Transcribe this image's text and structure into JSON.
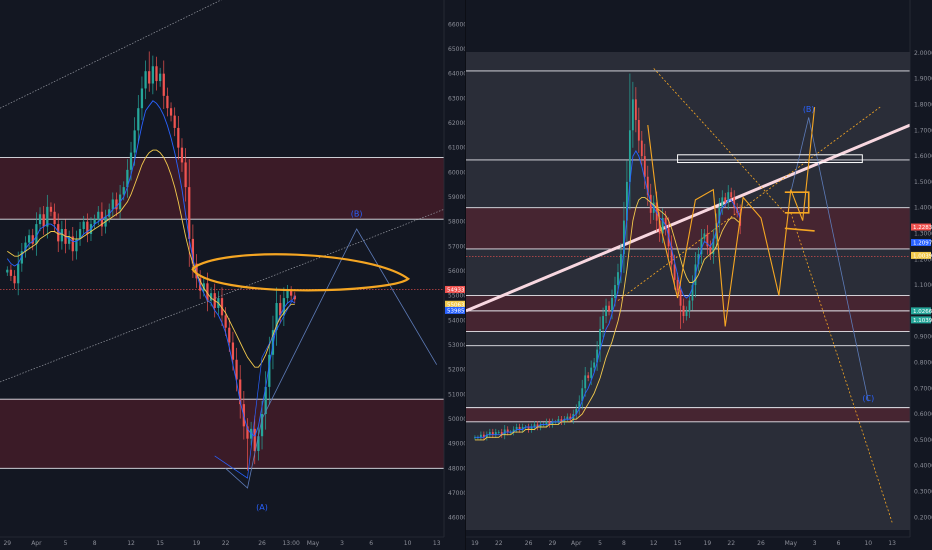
{
  "colors": {
    "background": "#131722",
    "candle_up": "#26a69a",
    "candle_down": "#ef5350",
    "ma_fast": "#2962ff",
    "ma_slow": "#f2c94c",
    "zone_fill": "#5c1f2b",
    "drawing_orange": "#f5a623",
    "trendline_pink": "#f8d7e0",
    "projection": "#9598a1"
  },
  "chart_data": [
    {
      "type": "candlestick",
      "panel": "left",
      "y_axis_labels": [
        "66000.00",
        "65000.00",
        "64000.00",
        "63000.00",
        "62000.00",
        "61000.00",
        "60000.00",
        "59000.00",
        "58000.00",
        "57000.00",
        "56000.00",
        "55000.00",
        "54000.00",
        "53000.00",
        "52000.00",
        "51000.00",
        "50000.00",
        "49000.00",
        "48000.00",
        "47000.00",
        "46000.00"
      ],
      "ylim": [
        45700,
        66500
      ],
      "x_tick_labels": [
        "29",
        "Apr",
        "5",
        "8",
        "12",
        "15",
        "19",
        "22",
        "26",
        "13:00",
        "May",
        "3",
        "6",
        "10",
        "13"
      ],
      "x_tick_index": [
        0,
        8,
        16,
        24,
        34,
        42,
        52,
        60,
        70,
        78,
        84,
        92,
        100,
        110,
        118
      ],
      "x_range": [
        -2,
        120
      ],
      "horizontal_levels": [
        60600,
        58100,
        50800,
        48000
      ],
      "zones": [
        [
          58100,
          60600
        ],
        [
          48000,
          50800
        ]
      ],
      "dotted_levels": [
        55250
      ],
      "price_tags": [
        {
          "text": "54933.13",
          "value": 55250,
          "color": "#ef5350"
        },
        {
          "text": "55063.81",
          "value": 54650,
          "color": "#f2c94c"
        },
        {
          "text": "53985.97",
          "value": 54400,
          "color": "#2962ff"
        }
      ],
      "wave_labels": [
        {
          "text": "(B)",
          "index": 96,
          "value": 58200
        },
        {
          "text": "(A)",
          "index": 70,
          "value": 46300
        }
      ],
      "closes": [
        56050,
        55800,
        55500,
        56300,
        56800,
        57150,
        57450,
        57100,
        57900,
        58300,
        57800,
        58600,
        58400,
        57900,
        57200,
        57700,
        57100,
        57400,
        56800,
        57300,
        57700,
        58000,
        57500,
        57900,
        58100,
        58400,
        57800,
        58200,
        58500,
        58900,
        58500,
        59100,
        59400,
        60100,
        60800,
        61700,
        62600,
        63400,
        64100,
        63600,
        64300,
        63700,
        64000,
        63100,
        62600,
        62300,
        61800,
        61000,
        60400,
        59400,
        57300,
        56300,
        55700,
        55200,
        55500,
        54800,
        55100,
        54500,
        54900,
        54200,
        53700,
        53100,
        52400,
        51600,
        50600,
        49700,
        49200,
        49600,
        48700,
        49300,
        50200,
        51300,
        52600,
        53600,
        54700,
        54200,
        54900,
        55200,
        55000,
        54850
      ],
      "highs": [
        null,
        null,
        null,
        null,
        null,
        null,
        null,
        null,
        null,
        null,
        null,
        null,
        null,
        null,
        null,
        null,
        null,
        null,
        null,
        null,
        null,
        null,
        null,
        null,
        null,
        null,
        null,
        null,
        null,
        null,
        null,
        null,
        null,
        null,
        null,
        null,
        null,
        null,
        null,
        64900,
        null,
        null,
        null,
        null,
        null,
        null,
        null,
        null,
        null,
        null,
        null,
        null,
        null,
        null,
        null,
        null,
        null,
        null,
        null,
        null,
        null,
        null,
        null,
        null,
        null,
        null,
        null,
        null,
        null,
        null,
        null,
        null,
        null,
        null,
        null,
        null,
        null,
        null,
        null,
        null
      ],
      "lows": [
        null,
        null,
        null,
        null,
        null,
        null,
        null,
        null,
        null,
        null,
        null,
        null,
        null,
        null,
        null,
        null,
        null,
        null,
        null,
        null,
        null,
        null,
        null,
        null,
        null,
        null,
        null,
        null,
        null,
        null,
        null,
        null,
        null,
        null,
        null,
        null,
        null,
        null,
        null,
        null,
        null,
        null,
        null,
        null,
        null,
        null,
        null,
        null,
        null,
        null,
        null,
        null,
        null,
        null,
        null,
        null,
        null,
        null,
        null,
        null,
        null,
        null,
        null,
        null,
        null,
        null,
        47900,
        null,
        null,
        null,
        null,
        null,
        null,
        null,
        null,
        null,
        null,
        null,
        null,
        null
      ],
      "ma_fast": [
        56500,
        56300,
        56200,
        56300,
        56600,
        56900,
        57100,
        57200,
        57400,
        57700,
        57800,
        57900,
        57900,
        57800,
        57600,
        57500,
        57400,
        57300,
        57200,
        57200,
        57300,
        57500,
        57600,
        57700,
        57900,
        58000,
        58100,
        58200,
        58300,
        58500,
        58600,
        58800,
        59000,
        59400,
        59900,
        60500,
        61200,
        61900,
        62500,
        62700,
        62900,
        62800,
        62600,
        62300,
        61900,
        61400,
        60800,
        60100,
        59300,
        58300,
        57300,
        56500,
        55900,
        55400,
        55100,
        54800,
        54700,
        54400,
        54200,
        53900,
        53500,
        52900,
        52200,
        51500,
        50700,
        50100,
        49600,
        49400,
        49300,
        49700,
        50500,
        51300,
        52200,
        53000,
        53800,
        54200,
        54500,
        54700,
        54800,
        54700
      ],
      "ma_slow": [
        56800,
        56700,
        56600,
        56600,
        56700,
        56800,
        56900,
        57000,
        57100,
        57300,
        57400,
        57500,
        57600,
        57600,
        57500,
        57500,
        57400,
        57400,
        57300,
        57300,
        57300,
        57400,
        57500,
        57600,
        57700,
        57800,
        57900,
        58000,
        58100,
        58200,
        58300,
        58400,
        58600,
        58800,
        59100,
        59500,
        59900,
        60300,
        60600,
        60800,
        60900,
        60900,
        60800,
        60600,
        60300,
        59900,
        59400,
        58800,
        58100,
        57400,
        56800,
        56300,
        55900,
        55600,
        55300,
        55100,
        54900,
        54800,
        54700,
        54500,
        54300,
        54000,
        53700,
        53400,
        53100,
        52800,
        52500,
        52300,
        52100,
        52100,
        52300,
        52600,
        53000,
        53400,
        53800,
        54100,
        54300,
        54500,
        54650,
        54650
      ],
      "projection_path": [
        [
          60,
          48000
        ],
        [
          66,
          47200
        ],
        [
          70,
          50000
        ],
        [
          96,
          57700
        ],
        [
          118,
          52200
        ]
      ],
      "projection_envelope": [
        [
          57,
          48500
        ],
        [
          66,
          47600
        ],
        [
          70,
          52500
        ],
        [
          79,
          55000
        ]
      ]
    },
    {
      "type": "candlestick",
      "panel": "right",
      "y_axis_labels": [
        "2.00000",
        "1.90000",
        "1.80000",
        "1.70000",
        "1.60000",
        "1.50000",
        "1.40000",
        "1.30000",
        "1.20000",
        "1.10000",
        "1.00000",
        "0.90000",
        "0.80000",
        "0.70000",
        "0.60000",
        "0.50000",
        "0.40000",
        "0.30000",
        "0.20000"
      ],
      "ylim": [
        0.17,
        2.05
      ],
      "x_tick_labels": [
        "19",
        "22",
        "26",
        "29",
        "Apr",
        "5",
        "8",
        "12",
        "15",
        "19",
        "22",
        "26",
        "May",
        "3",
        "6",
        "10",
        "13"
      ],
      "x_tick_index": [
        0,
        8,
        18,
        26,
        34,
        42,
        50,
        60,
        68,
        78,
        86,
        96,
        106,
        114,
        122,
        132,
        140
      ],
      "x_range": [
        -3,
        146
      ],
      "horizontal_levels": [
        1.93,
        1.585,
        1.4,
        1.24,
        1.06,
        1.0,
        0.92,
        0.865,
        0.625,
        0.57
      ],
      "zones": [
        [
          1.24,
          1.4
        ],
        [
          0.92,
          1.06
        ],
        [
          0.57,
          0.625
        ]
      ],
      "dotted_levels": [
        1.21
      ],
      "price_tags": [
        {
          "text": "1.22830",
          "value": 1.325,
          "color": "#ef5350"
        },
        {
          "text": "1.20979",
          "value": 1.265,
          "color": "#2962ff"
        },
        {
          "text": "1.00397",
          "value": 1.215,
          "color": "#f2c94c"
        },
        {
          "text": "1.02666",
          "value": 1.0,
          "color": "#26a69a"
        },
        {
          "text": "1.10396",
          "value": 0.965,
          "color": "#26a69a"
        }
      ],
      "wave_labels": [
        {
          "text": "(B)",
          "index": 112,
          "value": 1.77
        },
        {
          "text": "(C)",
          "index": 132,
          "value": 0.65
        }
      ],
      "closes": [
        0.51,
        0.51,
        0.52,
        0.51,
        0.52,
        0.53,
        0.52,
        0.53,
        0.53,
        0.52,
        0.54,
        0.53,
        0.53,
        0.54,
        0.55,
        0.54,
        0.55,
        0.55,
        0.54,
        0.55,
        0.56,
        0.55,
        0.56,
        0.56,
        0.57,
        0.56,
        0.57,
        0.57,
        0.58,
        0.57,
        0.58,
        0.59,
        0.58,
        0.6,
        0.62,
        0.65,
        0.7,
        0.75,
        0.74,
        0.78,
        0.8,
        0.85,
        0.93,
        0.98,
        1.02,
        1.0,
        1.05,
        1.1,
        1.15,
        1.22,
        1.35,
        1.5,
        1.7,
        1.82,
        1.74,
        1.66,
        1.6,
        1.52,
        1.45,
        1.38,
        1.42,
        1.35,
        1.3,
        1.36,
        1.32,
        1.25,
        1.18,
        1.12,
        1.08,
        1.02,
        0.98,
        1.0,
        1.04,
        1.1,
        1.18,
        1.22,
        1.28,
        1.3,
        1.25,
        1.22,
        1.28,
        1.34,
        1.4,
        1.44,
        1.42,
        1.46,
        1.44,
        1.4,
        1.38,
        1.33
      ],
      "highs": [
        null,
        null,
        null,
        null,
        null,
        null,
        null,
        null,
        null,
        null,
        null,
        null,
        null,
        null,
        null,
        null,
        null,
        null,
        null,
        null,
        null,
        null,
        null,
        null,
        null,
        null,
        null,
        null,
        null,
        null,
        null,
        null,
        null,
        null,
        null,
        null,
        null,
        null,
        null,
        null,
        null,
        null,
        null,
        null,
        null,
        null,
        null,
        null,
        null,
        null,
        null,
        null,
        1.92,
        null,
        null,
        null,
        null,
        null,
        null,
        null,
        null,
        null,
        null,
        null,
        null,
        null,
        null,
        null,
        null,
        null,
        null,
        null,
        null,
        null,
        null,
        null,
        null,
        null,
        null,
        null,
        null,
        null,
        null,
        null,
        null,
        null,
        null,
        null,
        null,
        null
      ],
      "lows": [
        null,
        null,
        null,
        null,
        null,
        null,
        null,
        null,
        null,
        null,
        null,
        null,
        null,
        null,
        null,
        null,
        null,
        null,
        null,
        null,
        null,
        null,
        null,
        null,
        null,
        null,
        null,
        null,
        null,
        null,
        null,
        null,
        null,
        null,
        null,
        null,
        null,
        null,
        null,
        null,
        null,
        null,
        null,
        null,
        null,
        null,
        null,
        null,
        null,
        null,
        null,
        null,
        null,
        null,
        null,
        null,
        null,
        null,
        null,
        null,
        null,
        null,
        null,
        null,
        null,
        null,
        null,
        null,
        null,
        0.93,
        null,
        null,
        null,
        null,
        null,
        null,
        null,
        null,
        null,
        null,
        null,
        null,
        null,
        null,
        null,
        null,
        null,
        null,
        null,
        null
      ],
      "ma_fast": [
        0.51,
        0.51,
        0.51,
        0.51,
        0.52,
        0.52,
        0.52,
        0.52,
        0.52,
        0.52,
        0.53,
        0.53,
        0.53,
        0.53,
        0.54,
        0.54,
        0.54,
        0.55,
        0.55,
        0.55,
        0.55,
        0.55,
        0.56,
        0.56,
        0.56,
        0.56,
        0.57,
        0.57,
        0.57,
        0.57,
        0.58,
        0.58,
        0.58,
        0.59,
        0.6,
        0.62,
        0.65,
        0.68,
        0.7,
        0.73,
        0.76,
        0.8,
        0.85,
        0.89,
        0.93,
        0.95,
        0.99,
        1.03,
        1.08,
        1.14,
        1.24,
        1.36,
        1.5,
        1.6,
        1.62,
        1.6,
        1.56,
        1.51,
        1.46,
        1.42,
        1.4,
        1.38,
        1.36,
        1.35,
        1.33,
        1.29,
        1.24,
        1.19,
        1.14,
        1.09,
        1.06,
        1.05,
        1.06,
        1.09,
        1.14,
        1.19,
        1.24,
        1.27,
        1.26,
        1.25,
        1.27,
        1.31,
        1.36,
        1.4,
        1.41,
        1.43,
        1.43,
        1.41,
        1.39,
        1.36
      ],
      "ma_slow": [
        0.5,
        0.5,
        0.5,
        0.5,
        0.51,
        0.51,
        0.51,
        0.51,
        0.51,
        0.52,
        0.52,
        0.52,
        0.52,
        0.53,
        0.53,
        0.53,
        0.53,
        0.54,
        0.54,
        0.54,
        0.54,
        0.55,
        0.55,
        0.55,
        0.55,
        0.56,
        0.56,
        0.56,
        0.56,
        0.57,
        0.57,
        0.57,
        0.57,
        0.58,
        0.58,
        0.59,
        0.6,
        0.62,
        0.64,
        0.66,
        0.68,
        0.71,
        0.74,
        0.78,
        0.82,
        0.85,
        0.88,
        0.92,
        0.96,
        1.01,
        1.08,
        1.16,
        1.26,
        1.35,
        1.4,
        1.43,
        1.44,
        1.44,
        1.43,
        1.42,
        1.41,
        1.4,
        1.39,
        1.38,
        1.37,
        1.35,
        1.32,
        1.28,
        1.24,
        1.2,
        1.16,
        1.13,
        1.11,
        1.11,
        1.12,
        1.14,
        1.17,
        1.2,
        1.21,
        1.22,
        1.23,
        1.25,
        1.28,
        1.31,
        1.33,
        1.35,
        1.36,
        1.36,
        1.35,
        1.34
      ],
      "trendline": [
        [
          -3,
          1.0
        ],
        [
          146,
          1.72
        ]
      ],
      "projection_path": [
        [
          106,
          1.46
        ],
        [
          112,
          1.75
        ],
        [
          132,
          0.65
        ]
      ],
      "retracement_line": [
        [
          60,
          1.94
        ],
        [
          104,
          1.38
        ]
      ],
      "fan_line_up": [
        [
          48,
          1.04
        ],
        [
          136,
          1.79
        ]
      ],
      "fan_line_down": [
        [
          106,
          1.38
        ],
        [
          140,
          0.18
        ]
      ]
    }
  ]
}
